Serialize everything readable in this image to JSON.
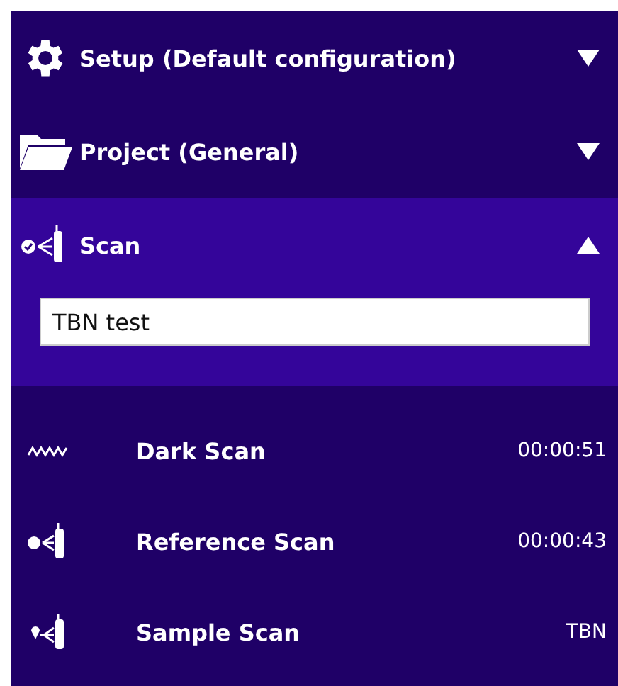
{
  "sections": [
    {
      "kind": "gear",
      "title": "Setup (Default configuration)",
      "expanded": false
    },
    {
      "kind": "folder",
      "title": "Project (General)",
      "expanded": false
    },
    {
      "kind": "scan",
      "title": "Scan",
      "expanded": true,
      "field": {
        "value": "TBN test"
      },
      "steps": [
        {
          "kind": "dark",
          "name": "Dark Scan",
          "value": "00:00:51"
        },
        {
          "kind": "reference",
          "name": "Reference Scan",
          "value": "00:00:43"
        },
        {
          "kind": "sample",
          "name": "Sample Scan",
          "value": "TBN"
        }
      ]
    }
  ]
}
